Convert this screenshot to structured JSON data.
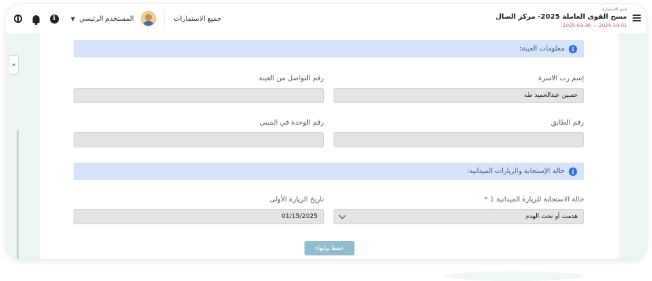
{
  "header": {
    "form_name_label": "اسم الاستمارة",
    "form_name": "مسح القوى العاملة 2025- مركز الصال",
    "form_dates": "2025-03-30 — 2024-10-01",
    "all_forms_label": "جميع الاستمارات",
    "user_label": "المستخدم الرئيسي"
  },
  "sidebar": {
    "tab_label": "»"
  },
  "sections": {
    "sample_info": {
      "title": "معلومات العينة:"
    },
    "response_status": {
      "title": "حالة الإستجابة والزيارات الميدانية:"
    }
  },
  "fields": {
    "head_name": {
      "label": "إسم رب الاسرة",
      "value": "حسين عبدالحميد طه"
    },
    "contact_number": {
      "label": "رقم التواصل من العينة",
      "value": ""
    },
    "floor_number": {
      "label": "رقم الطابق",
      "value": ""
    },
    "unit_number": {
      "label": "رقم الوحدة في المبنى",
      "value": ""
    },
    "visit_response": {
      "label": "حالة الاستجابة للزيارة الميدانية 1",
      "required_mark": "*",
      "value": "هدمت أو تحت الهدم"
    },
    "first_visit_date": {
      "label": "تاريخ الزيارة الأولى",
      "value": "01/15/2025"
    }
  },
  "actions": {
    "save_finish_label": "حفظ وإنهاء"
  },
  "colors": {
    "accent": "#2f6fe4",
    "section_bg": "#d7e3fb",
    "button_bg": "#8fbccf",
    "date_accent": "#e0457b"
  }
}
